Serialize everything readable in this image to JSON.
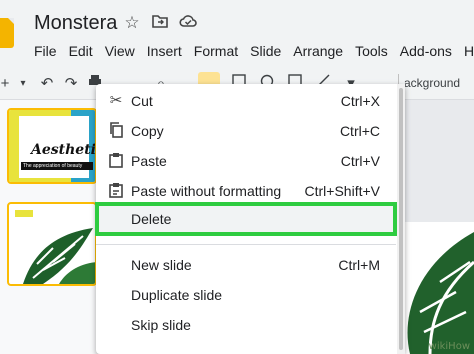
{
  "header": {
    "title": "Monstera",
    "icons": [
      "star-icon",
      "move-to-folder-icon",
      "cloud-saved-icon"
    ],
    "menu": [
      "File",
      "Edit",
      "View",
      "Insert",
      "Format",
      "Slide",
      "Arrange",
      "Tools",
      "Add-ons",
      "He"
    ]
  },
  "toolbar": {
    "icons": [
      "new-slide-icon",
      "dropdown-arrow-icon",
      "undo-icon",
      "redo-icon",
      "print-icon",
      "paint-format-icon",
      "zoom-icon",
      "select-icon",
      "text-box-icon",
      "image-icon",
      "shape-icon",
      "line-icon",
      "comment-icon"
    ],
    "background_label": "Background",
    "background_display": "ackground"
  },
  "filmstrip": {
    "slide1_title": "Aesthetic",
    "slide1_subtitle": "The appreciation of beauty"
  },
  "context_menu": {
    "items": [
      {
        "label": "Cut",
        "shortcut": "Ctrl+X",
        "icon": "scissors-icon"
      },
      {
        "label": "Copy",
        "shortcut": "Ctrl+C",
        "icon": "copy-icon"
      },
      {
        "label": "Paste",
        "shortcut": "Ctrl+V",
        "icon": "clipboard-icon"
      },
      {
        "label": "Paste without formatting",
        "shortcut": "Ctrl+Shift+V",
        "icon": "clipboard-text-icon"
      },
      {
        "label": "Delete",
        "shortcut": "",
        "icon": ""
      },
      {
        "label": "New slide",
        "shortcut": "Ctrl+M",
        "icon": ""
      },
      {
        "label": "Duplicate slide",
        "shortcut": "",
        "icon": ""
      },
      {
        "label": "Skip slide",
        "shortcut": "",
        "icon": ""
      }
    ],
    "highlight_color": "#2ecc40"
  },
  "watermark": "wikiHow"
}
